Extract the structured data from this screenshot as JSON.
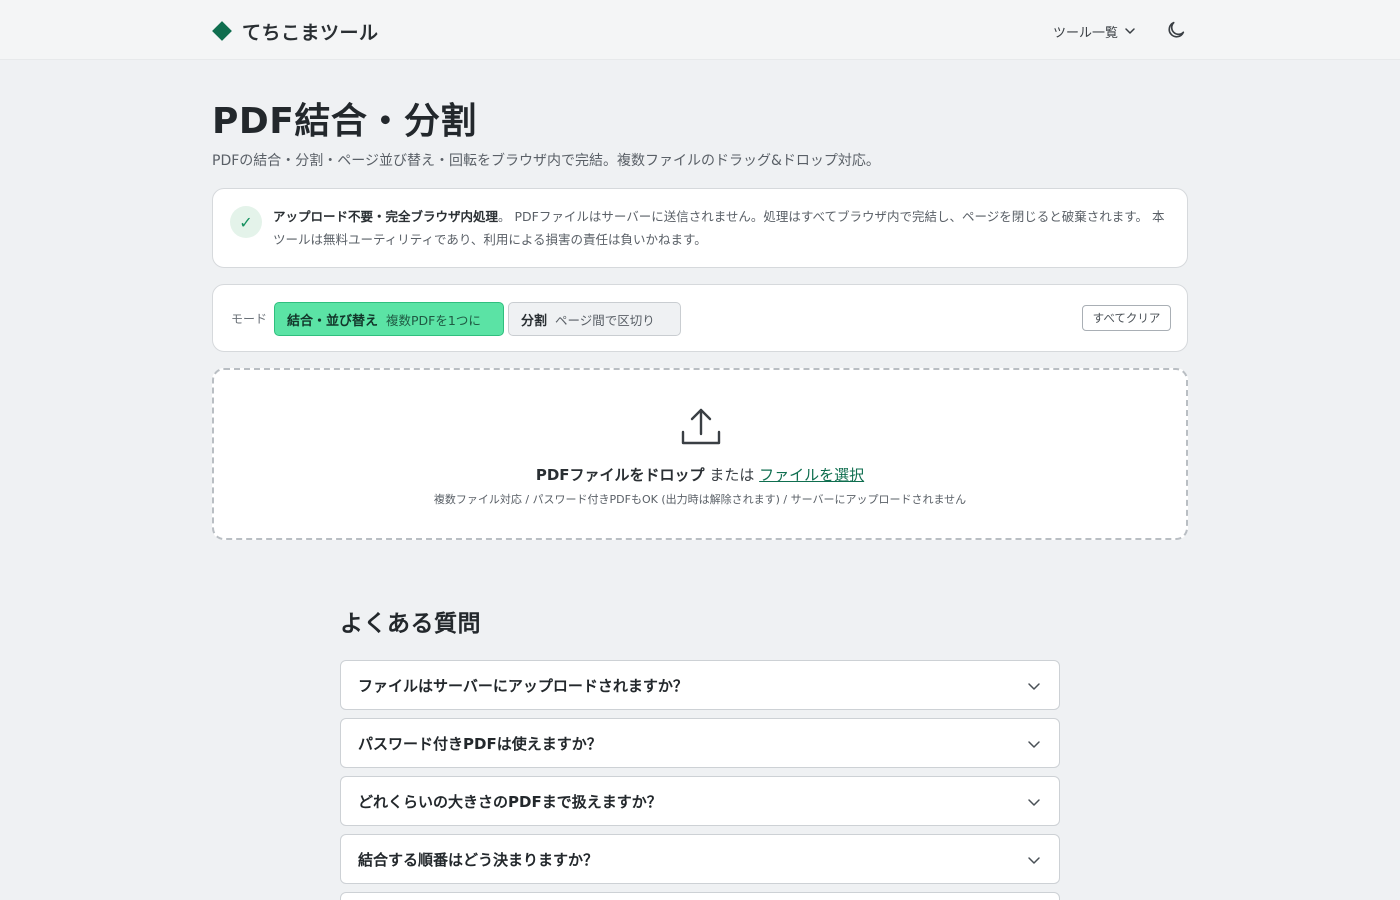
{
  "header": {
    "brand": "てちこまツール",
    "tools_menu": "ツール一覧"
  },
  "page": {
    "title": "PDF結合・分割",
    "description": "PDFの結合・分割・ページ並び替え・回転をブラウザ内で完結。複数ファイルのドラッグ&ドロップ対応。"
  },
  "notice": {
    "bold": "アップロード不要・完全ブラウザ内処理",
    "text": "。 PDFファイルはサーバーに送信されません。処理はすべてブラウザ内で完結し、ページを閉じると破棄されます。 本ツールは無料ユーティリティであり、利用による損害の責任は負いかねます。"
  },
  "mode": {
    "label": "モード",
    "options": [
      {
        "main": "結合・並び替え",
        "sub": "複数PDFを1つに",
        "active": true
      },
      {
        "main": "分割",
        "sub": "ページ間で区切り",
        "active": false
      }
    ],
    "clear": "すべてクリア"
  },
  "dropzone": {
    "drop_text": "PDFファイルをドロップ",
    "or_text": "または",
    "pick_text": "ファイルを選択",
    "sub_text": "複数ファイル対応 / パスワード付きPDFもOK (出力時は解除されます) / サーバーにアップロードされません"
  },
  "faq": {
    "title": "よくある質問",
    "items": [
      "ファイルはサーバーにアップロードされますか？",
      "パスワード付きPDFは使えますか？",
      "どれくらいの大きさのPDFまで扱えますか？",
      "結合する順番はどう決まりますか？"
    ]
  },
  "colors": {
    "accent": "#0f6e4f",
    "active_mode_bg": "#5be3a5",
    "page_bg": "#eff1f3"
  }
}
